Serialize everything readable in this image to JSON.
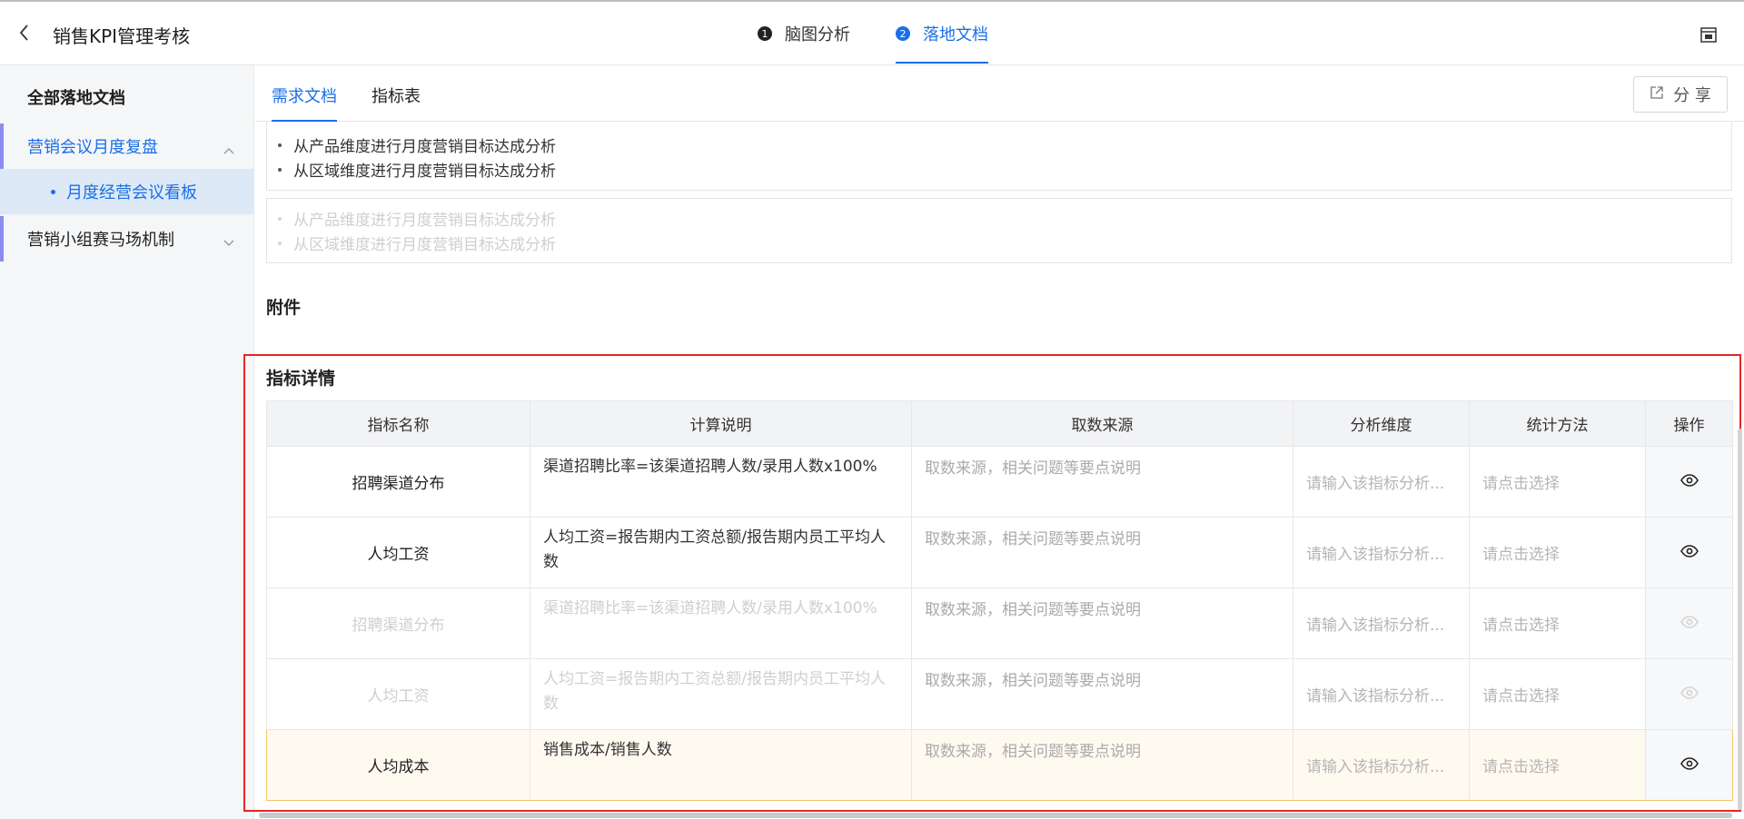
{
  "header": {
    "title": "销售KPI管理考核",
    "steps": [
      {
        "num": "1",
        "label": "脑图分析"
      },
      {
        "num": "2",
        "label": "落地文档"
      }
    ]
  },
  "sidebar": {
    "heading": "全部落地文档",
    "groups": [
      {
        "label": "营销会议月度复盘",
        "children": [
          {
            "label": "月度经营会议看板"
          }
        ]
      },
      {
        "label": "营销小组赛马场机制"
      }
    ]
  },
  "main": {
    "tabs": [
      {
        "label": "需求文档"
      },
      {
        "label": "指标表"
      }
    ],
    "share_label": "分 享",
    "doc_block_1": [
      "从产品维度进行月度营销目标达成分析",
      "从区域维度进行月度营销目标达成分析"
    ],
    "doc_block_2": [
      "从产品维度进行月度营销目标达成分析",
      "从区域维度进行月度营销目标达成分析"
    ],
    "attachments_title": "附件",
    "detail_title": "指标详情",
    "table": {
      "columns": [
        "指标名称",
        "计算说明",
        "取数来源",
        "分析维度",
        "统计方法",
        "操作"
      ],
      "rows": [
        {
          "name": "招聘渠道分布",
          "calc": "渠道招聘比率=该渠道招聘人数/录用人数x100%",
          "source": "取数来源，相关问题等要点说明",
          "dimension": "请输入该指标分析...",
          "method": "请点击选择"
        },
        {
          "name": "人均工资",
          "calc": "人均工资=报告期内工资总额/报告期内员工平均人数",
          "source": "取数来源，相关问题等要点说明",
          "dimension": "请输入该指标分析...",
          "method": "请点击选择"
        },
        {
          "name": "招聘渠道分布",
          "calc": "渠道招聘比率=该渠道招聘人数/录用人数x100%",
          "source": "取数来源，相关问题等要点说明",
          "dimension": "请输入该指标分析...",
          "method": "请点击选择"
        },
        {
          "name": "人均工资",
          "calc": "人均工资=报告期内工资总额/报告期内员工平均人数",
          "source": "取数来源，相关问题等要点说明",
          "dimension": "请输入该指标分析...",
          "method": "请点击选择"
        },
        {
          "name": "人均成本",
          "calc": "销售成本/销售人数",
          "source": "取数来源，相关问题等要点说明",
          "dimension": "请输入该指标分析...",
          "method": "请点击选择"
        }
      ]
    }
  },
  "colors": {
    "accent": "#1a6fe8",
    "highlight_frame": "#e62626",
    "row_highlight": "#f0c46c"
  },
  "icons": [
    "back-arrow-icon",
    "layout-panel-icon",
    "chevron-up-icon",
    "chevron-down-icon",
    "share-icon",
    "eye-icon"
  ]
}
